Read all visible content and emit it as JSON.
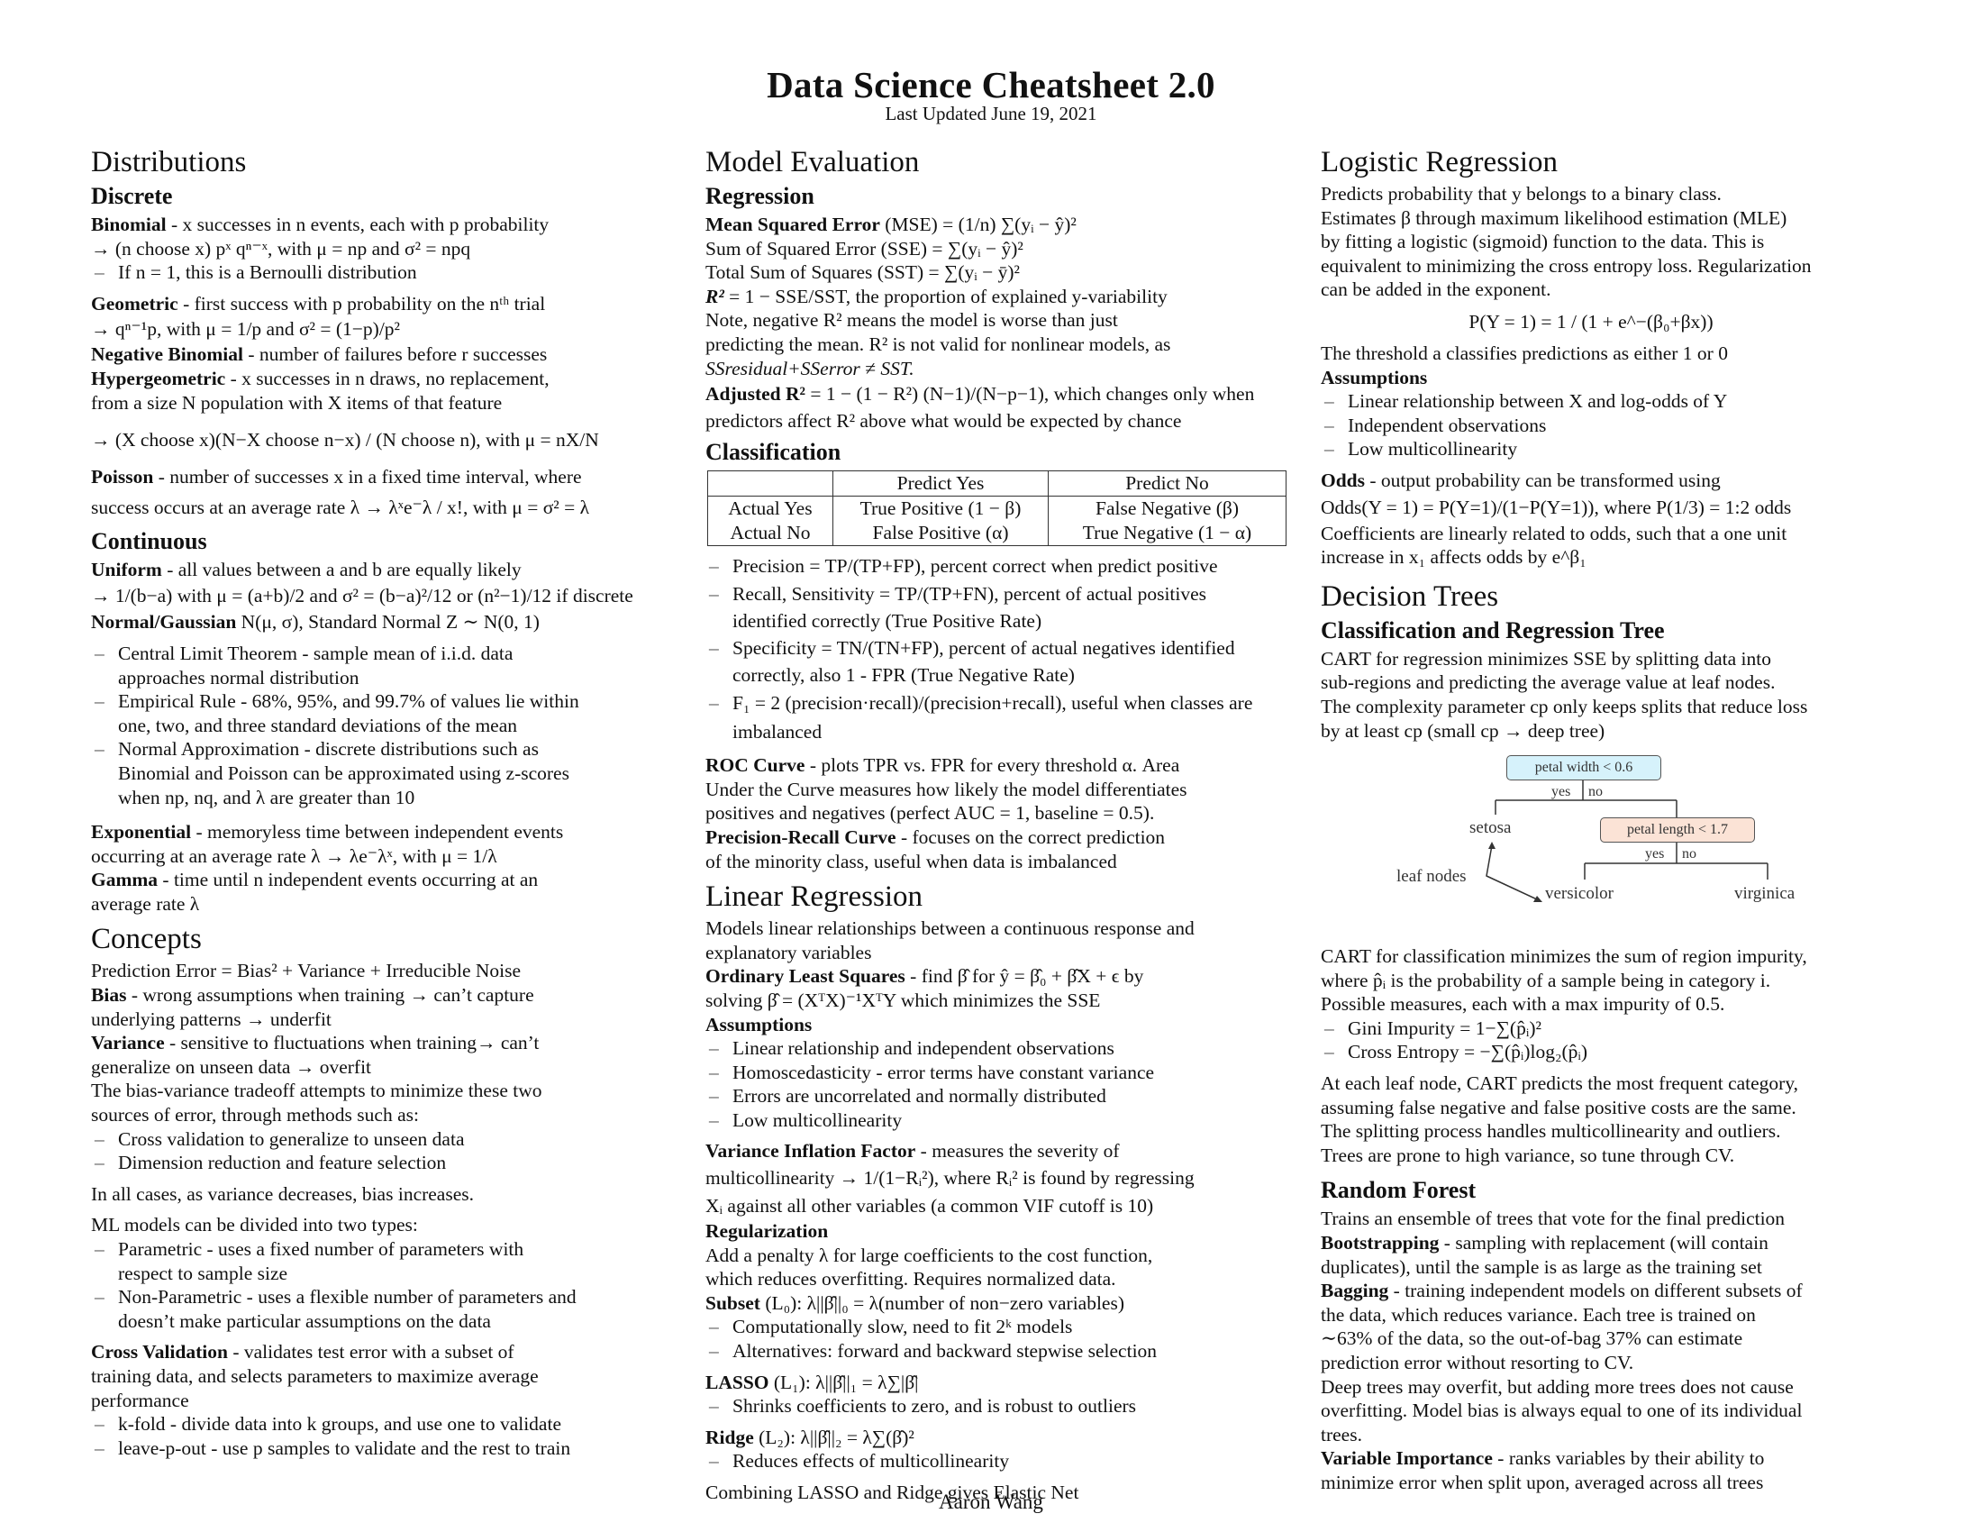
{
  "header": {
    "title": "Data Science Cheatsheet 2.0",
    "subtitle": "Last Updated June 19, 2021"
  },
  "footer": {
    "author": "Aaron Wang"
  },
  "distributions": {
    "heading": "Distributions",
    "discrete": {
      "heading": "Discrete",
      "binomial": {
        "term": "Binomial",
        "l1": " - x successes in n events, each with p probability",
        "l2": "→ (n choose x) pˣ qⁿ⁻ˣ, with μ = np and σ² = npq",
        "bullet": "If n = 1, this is a Bernoulli distribution"
      },
      "geometric": {
        "term": "Geometric",
        "l1": " - first success with p probability on the nᵗʰ trial",
        "l2": "→ qⁿ⁻¹p, with μ = 1/p and σ² = (1−p)/p²"
      },
      "negative_binomial": {
        "term": "Negative Binomial",
        "text": " - number of failures before r successes"
      },
      "hypergeometric": {
        "term": "Hypergeometric",
        "l1": " - x successes in n draws, no replacement,",
        "l2": "from a size N population with X items of that feature",
        "l3": "→ (X choose x)(N−X choose n−x) / (N choose n), with μ = nX/N"
      },
      "poisson": {
        "term": "Poisson",
        "l1": " - number of successes x in a fixed time interval, where",
        "l2": "success occurs at an average rate λ → λˣe⁻λ / x!, with μ = σ² = λ"
      }
    },
    "continuous": {
      "heading": "Continuous",
      "uniform": {
        "term": "Uniform",
        "l1": " - all values between a and b are equally likely",
        "l2": "→ 1/(b−a) with μ = (a+b)/2 and σ² = (b−a)²/12 or (n²−1)/12 if discrete"
      },
      "normal": {
        "term": "Normal/Gaussian",
        "text": " N(μ, σ), Standard Normal Z ∼ N(0, 1)",
        "bullets": [
          [
            "Central Limit Theorem - sample mean of i.i.d. data",
            "approaches normal distribution"
          ],
          [
            "Empirical Rule - 68%, 95%, and 99.7% of values lie within",
            "one, two, and three standard deviations of the mean"
          ],
          [
            "Normal Approximation - discrete distributions such as",
            "Binomial and Poisson can be approximated using z-scores",
            "when np, nq, and λ are greater than 10"
          ]
        ]
      },
      "exponential": {
        "term": "Exponential",
        "l1": " - memoryless time between independent events",
        "l2": "occurring at an average rate λ → λe⁻λˣ, with μ = 1/λ"
      },
      "gamma": {
        "term": "Gamma",
        "l1": " - time until n independent events occurring at an",
        "l2": "average rate λ"
      }
    }
  },
  "concepts": {
    "heading": "Concepts",
    "prediction_error": "Prediction Error = Bias² + Variance + Irreducible Noise",
    "bias": {
      "term": "Bias",
      "l1": " - wrong assumptions when training → can’t capture",
      "l2": "underlying patterns → underfit"
    },
    "variance": {
      "term": "Variance",
      "l1": " - sensitive to fluctuations when training→ can’t",
      "l2": "generalize on unseen data → overfit"
    },
    "tradeoff": {
      "l1": "The bias-variance tradeoff attempts to minimize these two",
      "l2": "sources of error, through methods such as:",
      "bullets": [
        "Cross validation to generalize to unseen data",
        "Dimension reduction and feature selection"
      ]
    },
    "all_cases": "In all cases, as variance decreases, bias increases.",
    "ml_types": {
      "intro": "ML models can be divided into two types:",
      "bullets": [
        [
          "Parametric - uses a fixed number of parameters with",
          "respect to sample size"
        ],
        [
          "Non-Parametric - uses a flexible number of parameters and",
          "doesn’t make particular assumptions on the data"
        ]
      ]
    },
    "cross_validation": {
      "term": "Cross Validation",
      "l1": " - validates test error with a subset of",
      "l2": "training data, and selects parameters to maximize average",
      "l3": "performance",
      "bullets": [
        "k-fold - divide data into k groups, and use one to validate",
        "leave-p-out - use p samples to validate and the rest to train"
      ]
    }
  },
  "model_evaluation": {
    "heading": "Model Evaluation",
    "regression": {
      "heading": "Regression",
      "mse": {
        "term": "Mean Squared Error",
        "text": " (MSE) = (1/n) ∑(yᵢ − ŷ)²"
      },
      "sse": "Sum of Squared Error (SSE) = ∑(yᵢ − ŷ)²",
      "sst": "Total Sum of Squares (SST) = ∑(yᵢ − ȳ)²",
      "r2": {
        "term": "R²",
        "text": " = 1 − SSE/SST, the proportion of explained y-variability"
      },
      "note": [
        "Note, negative R² means the model is worse than just",
        "predicting the mean. R² is not valid for nonlinear models, as",
        "SSresidual+SSerror ≠ SST."
      ],
      "adjusted": {
        "term": "Adjusted R²",
        "l1": " = 1 − (1 − R²) (N−1)/(N−p−1), which changes only when",
        "l2": "predictors affect R² above what would be expected by chance"
      }
    },
    "classification": {
      "heading": "Classification",
      "table": {
        "headers": [
          "",
          "Predict Yes",
          "Predict No"
        ],
        "rows": [
          [
            "Actual Yes",
            "True Positive (1 − β)",
            "False Negative (β)"
          ],
          [
            "Actual No",
            "False Positive (α)",
            "True Negative (1 − α)"
          ]
        ]
      },
      "bullets": [
        [
          "Precision = TP/(TP+FP), percent correct when predict positive"
        ],
        [
          "Recall, Sensitivity = TP/(TP+FN), percent of actual positives",
          "identified correctly (True Positive Rate)"
        ],
        [
          "Specificity = TN/(TN+FP), percent of actual negatives identified",
          "correctly, also 1 - FPR (True Negative Rate)"
        ],
        [
          "F₁ = 2 (precision·recall)/(precision+recall), useful when classes are imbalanced"
        ]
      ],
      "roc": {
        "term": "ROC Curve",
        "l1": " - plots TPR vs. FPR for every threshold α. Area",
        "l2": "Under the Curve measures how likely the model differentiates",
        "l3": "positives and negatives (perfect AUC = 1, baseline = 0.5)."
      },
      "pr": {
        "term": "Precision-Recall Curve",
        "l1": " - focuses on the correct prediction",
        "l2": "of the minority class, useful when data is imbalanced"
      }
    }
  },
  "linear_regression": {
    "heading": "Linear Regression",
    "intro": [
      "Models linear relationships between a continuous response and",
      "explanatory variables"
    ],
    "ols": {
      "term": "Ordinary Least Squares",
      "l1": " - find β̂ for ŷ = β̂₀ + β̂X + ϵ by",
      "l2": "solving β̂ = (XᵀX)⁻¹XᵀY which minimizes the SSE"
    },
    "assumptions": {
      "heading": "Assumptions",
      "bullets": [
        "Linear relationship and independent observations",
        "Homoscedasticity - error terms have constant variance",
        "Errors are uncorrelated and normally distributed",
        "Low multicollinearity"
      ]
    },
    "vif": {
      "term": "Variance Inflation Factor",
      "l1": " - measures the severity of",
      "l2": "multicollinearity → 1/(1−Rᵢ²), where Rᵢ² is found by regressing",
      "l3": "Xᵢ against all other variables (a common VIF cutoff is 10)"
    },
    "regularization": {
      "heading": "Regularization",
      "l1": "Add a penalty λ for large coefficients to the cost function,",
      "l2": "which reduces overfitting. Requires normalized data.",
      "subset": {
        "term": "Subset",
        "text": " (L₀): λ||β̂||₀ = λ(number of non−zero variables)"
      },
      "subset_bullets": [
        "Computationally slow, need to fit 2ᵏ models",
        "Alternatives: forward and backward stepwise selection"
      ],
      "lasso": {
        "term": "LASSO",
        "text": " (L₁): λ||β̂||₁ = λ∑|β̂|"
      },
      "lasso_bullets": [
        "Shrinks coefficients to zero, and is robust to outliers"
      ],
      "ridge": {
        "term": "Ridge",
        "text": " (L₂): λ||β̂||₂ = λ∑(β̂)²"
      },
      "ridge_bullets": [
        "Reduces effects of multicollinearity"
      ],
      "elastic": "Combining LASSO and Ridge gives Elastic Net"
    }
  },
  "logistic_regression": {
    "heading": "Logistic Regression",
    "intro": [
      "Predicts probability that y belongs to a binary class.",
      "Estimates β through maximum likelihood estimation (MLE)",
      "by fitting a logistic (sigmoid) function to the data. This is",
      "equivalent to minimizing the cross entropy loss. Regularization",
      "can be added in the exponent."
    ],
    "formula": "P(Y = 1) = 1 / (1 + e^−(β₀+βx))",
    "threshold": "The threshold a classifies predictions as either 1 or 0",
    "assumptions": {
      "heading": "Assumptions",
      "bullets": [
        "Linear relationship between X and log-odds of Y",
        "Independent observations",
        "Low multicollinearity"
      ]
    },
    "odds": {
      "term": "Odds",
      "l1": " - output probability can be transformed using",
      "l2": "Odds(Y = 1) = P(Y=1)/(1−P(Y=1)), where P(1/3) = 1:2 odds",
      "l3": "Coefficients are linearly related to odds, such that a one unit",
      "l4": "increase in x₁ affects odds by e^β₁"
    }
  },
  "decision_trees": {
    "heading": "Decision Trees",
    "cart": {
      "heading": "Classification and Regression Tree",
      "intro": [
        "CART for regression minimizes SSE by splitting data into",
        "sub-regions and predicting the average value at leaf nodes.",
        "The complexity parameter cp only keeps splits that reduce loss",
        "by at least cp (small cp → deep tree)"
      ],
      "diagram": {
        "root": "petal width < 0.6",
        "inner": "petal length < 1.7",
        "yes": "yes",
        "no": "no",
        "leaves": [
          "setosa",
          "versicolor",
          "virginica"
        ],
        "annotation": "leaf nodes",
        "root_color": "#d6f2fb",
        "inner_color": "#fbe3d6"
      },
      "classification": [
        "CART for classification minimizes the sum of region impurity,",
        "where p̂ᵢ is the probability of a sample being in category i.",
        "Possible measures, each with a max impurity of 0.5."
      ],
      "measures": [
        "Gini Impurity = 1−∑(p̂ᵢ)²",
        "Cross Entropy = −∑(p̂ᵢ)log₂(p̂ᵢ)"
      ],
      "leaf_text": [
        "At each leaf node, CART predicts the most frequent category,",
        "assuming false negative and false positive costs are the same.",
        "The splitting process handles multicollinearity and outliers.",
        "Trees are prone to high variance, so tune through CV."
      ]
    },
    "random_forest": {
      "heading": "Random Forest",
      "intro": "Trains an ensemble of trees that vote for the final prediction",
      "bootstrapping": {
        "term": "Bootstrapping",
        "l1": " - sampling with replacement (will contain",
        "l2": "duplicates), until the sample is as large as the training set"
      },
      "bagging": {
        "term": "Bagging",
        "l1": " - training independent models on different subsets of",
        "l2": "the data, which reduces variance. Each tree is trained on",
        "l3": "∼63% of the data, so the out-of-bag 37% can estimate",
        "l4": "prediction error without resorting to CV."
      },
      "deep_trees": [
        "Deep trees may overfit, but adding more trees does not cause",
        "overfitting. Model bias is always equal to one of its individual",
        "trees."
      ],
      "var_importance": {
        "term": "Variable Importance",
        "l1": " - ranks variables by their ability to",
        "l2": "minimize error when split upon, averaged across all trees"
      }
    }
  }
}
